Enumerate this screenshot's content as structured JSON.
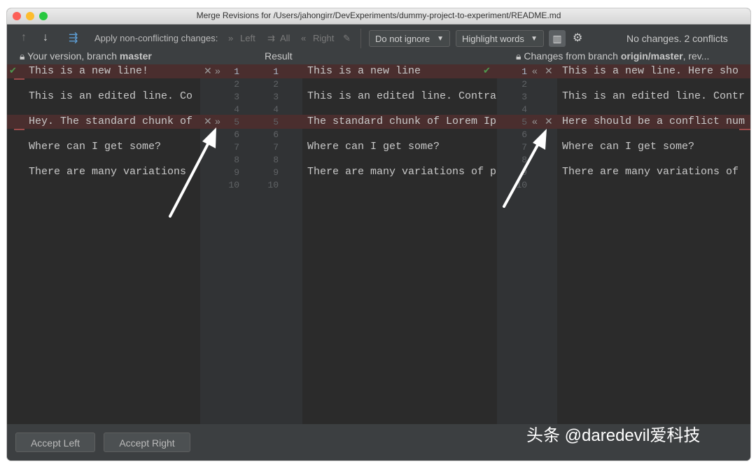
{
  "window": {
    "title": "Merge Revisions for /Users/jahongirr/DevExperiments/dummy-project-to-experiment/README.md"
  },
  "toolbar": {
    "apply_label": "Apply non-conflicting changes:",
    "left_label": "Left",
    "all_label": "All",
    "right_label": "Right",
    "ignore_combo": "Do not ignore",
    "highlight_combo": "Highlight words",
    "status": "No changes. 2 conflicts"
  },
  "headers": {
    "left_prefix": "Your version, branch ",
    "left_branch": "master",
    "center": "Result",
    "right_prefix": "Changes from branch ",
    "right_branch": "origin/master",
    "right_suffix": ", rev..."
  },
  "left_pane": {
    "lines": [
      "This is a new line!",
      "This is an edited line. Co",
      "Hey. The standard chunk of",
      "Where can I get some?",
      "There are many variations"
    ]
  },
  "result_pane": {
    "lines": [
      "This is a new line",
      "This is an edited line. Contra",
      "The standard chunk of Lorem Ip",
      "Where can I get some?",
      "There are many variations of p"
    ]
  },
  "right_pane": {
    "lines": [
      "This is a new line. Here sho",
      "This is an edited line. Contr",
      "Here should be a conflict num",
      "Where can I get some?",
      "There are many variations of"
    ]
  },
  "line_numbers": [
    "1",
    "2",
    "3",
    "4",
    "5",
    "6",
    "7",
    "8",
    "9",
    "10"
  ],
  "icons": {
    "apply": "apply-icon",
    "settings": "gear-icon",
    "columns": "columns-icon",
    "lock": "lock-icon"
  },
  "buttons": {
    "accept_left": "Accept Left",
    "accept_right": "Accept Right"
  },
  "watermark": "头条 @daredevil爱科技",
  "colors": {
    "background": "#2b2b2b",
    "conflict": "#4a2e2e",
    "accent_green": "#4f9b4f"
  }
}
